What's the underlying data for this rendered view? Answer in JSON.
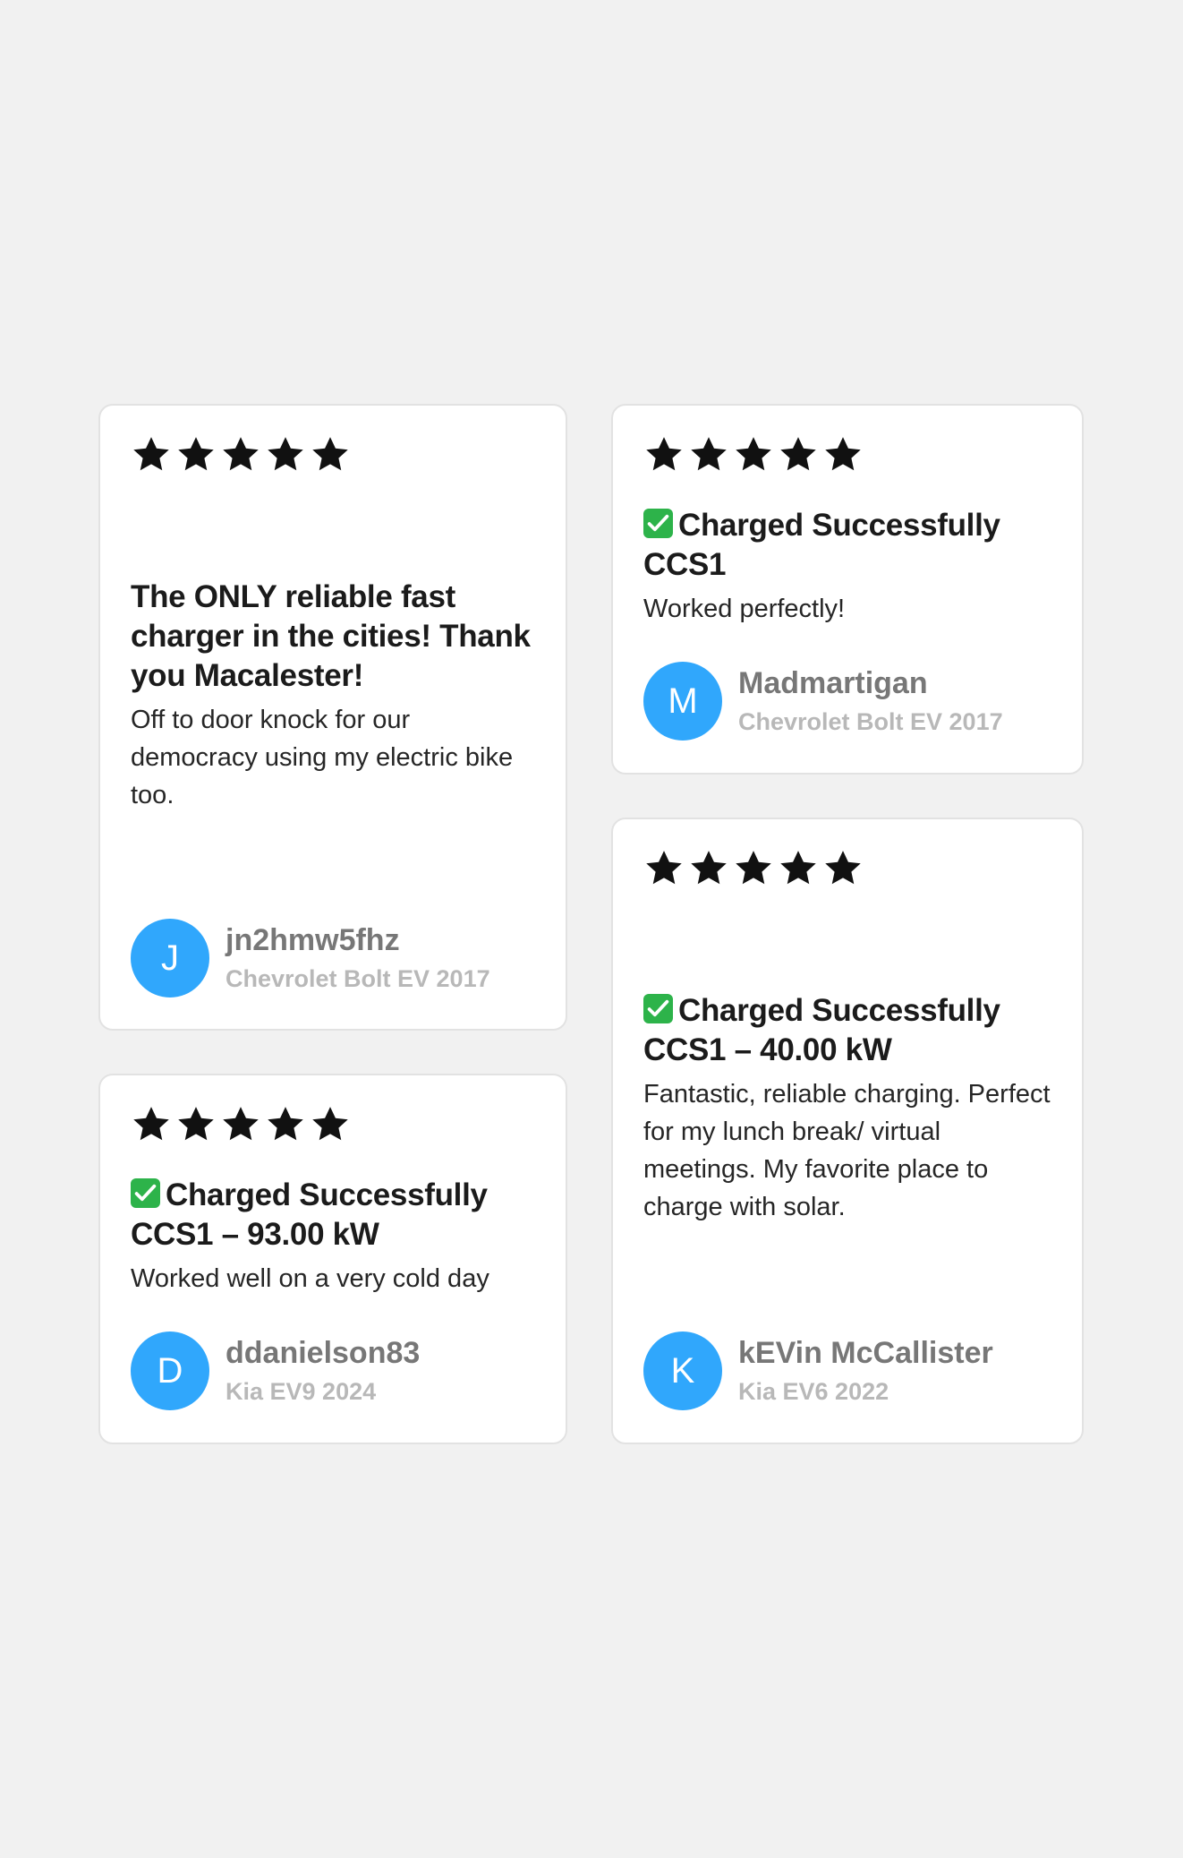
{
  "colors": {
    "background": "#f1f1f1",
    "card": "#ffffff",
    "avatar": "#30a7fc",
    "check": "#2db34a",
    "star": "#111111"
  },
  "reviews": [
    {
      "rating": 5,
      "headline": "The ONLY reliable fast charger in the cities! Thank you Macalester!",
      "has_check": false,
      "body": "Off to door knock for our democracy using my electric bike too.",
      "avatar_letter": "J",
      "username": "jn2hmw5fhz",
      "vehicle": "Chevrolet Bolt EV 2017"
    },
    {
      "rating": 5,
      "headline": "Charged Successfully CCS1",
      "has_check": true,
      "body": "Worked perfectly!",
      "avatar_letter": "M",
      "username": "Madmartigan",
      "vehicle": "Chevrolet Bolt EV 2017"
    },
    {
      "rating": 5,
      "headline": "Charged Successfully CCS1 – 93.00 kW",
      "has_check": true,
      "body": "Worked well on a very cold day",
      "avatar_letter": "D",
      "username": "ddanielson83",
      "vehicle": "Kia EV9 2024"
    },
    {
      "rating": 5,
      "headline": "Charged Successfully CCS1 – 40.00 kW",
      "has_check": true,
      "body": "Fantastic, reliable charging. Perfect for my lunch break/ virtual meetings. My favorite place to charge with solar.",
      "avatar_letter": "K",
      "username": "kEVin McCallister",
      "vehicle": "Kia EV6 2022"
    }
  ]
}
